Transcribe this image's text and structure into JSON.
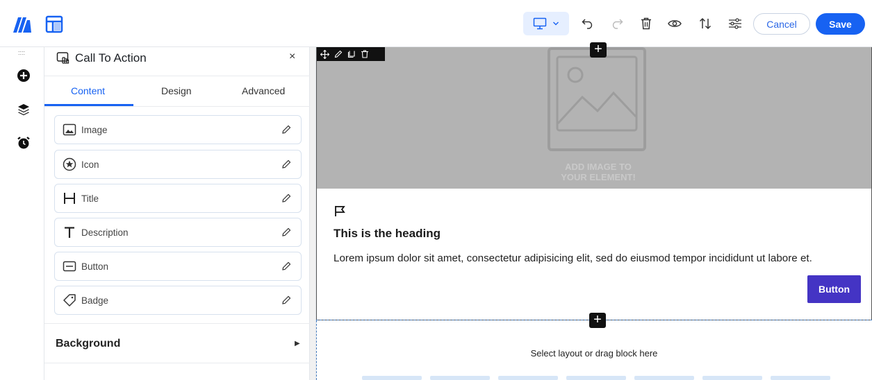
{
  "toolbar": {
    "logo_icon": "brand-logo-icon",
    "layout_icon": "layout-icon",
    "device_icon": "desktop-icon",
    "icons": [
      "undo-icon",
      "redo-icon",
      "trash-icon",
      "eye-icon",
      "sort-arrows-icon",
      "sliders-icon"
    ],
    "cancel_label": "Cancel",
    "save_label": "Save",
    "accent_color": "#1762f2"
  },
  "rail": {
    "grip": "::::",
    "icons": [
      "add-circle-icon",
      "layers-icon",
      "alarm-clock-icon"
    ]
  },
  "panel": {
    "title": "Call To Action",
    "close": "×",
    "tabs": [
      {
        "label": "Content",
        "active": true
      },
      {
        "label": "Design",
        "active": false
      },
      {
        "label": "Advanced",
        "active": false
      }
    ],
    "items": [
      {
        "label": "Image",
        "icon": "image-icon"
      },
      {
        "label": "Icon",
        "icon": "star-circle-icon"
      },
      {
        "label": "Title",
        "icon": "heading-h-icon"
      },
      {
        "label": "Description",
        "icon": "text-t-icon"
      },
      {
        "label": "Button",
        "icon": "button-icon"
      },
      {
        "label": "Badge",
        "icon": "tag-icon"
      }
    ],
    "background_label": "Background",
    "background_arrow": "▶"
  },
  "canvas": {
    "image_placeholder_text_line1": "ADD IMAGE TO",
    "image_placeholder_text_line2": "YOUR ELEMENT!",
    "heading": "This is the heading",
    "description": "Lorem ipsum dolor sit amet, consectetur adipisicing elit, sed do eiusmod tempor incididunt ut labore et.",
    "button_label": "Button",
    "button_color": "#4434c4",
    "dropzone_text": "Select layout or drag block here",
    "plus": "+"
  }
}
